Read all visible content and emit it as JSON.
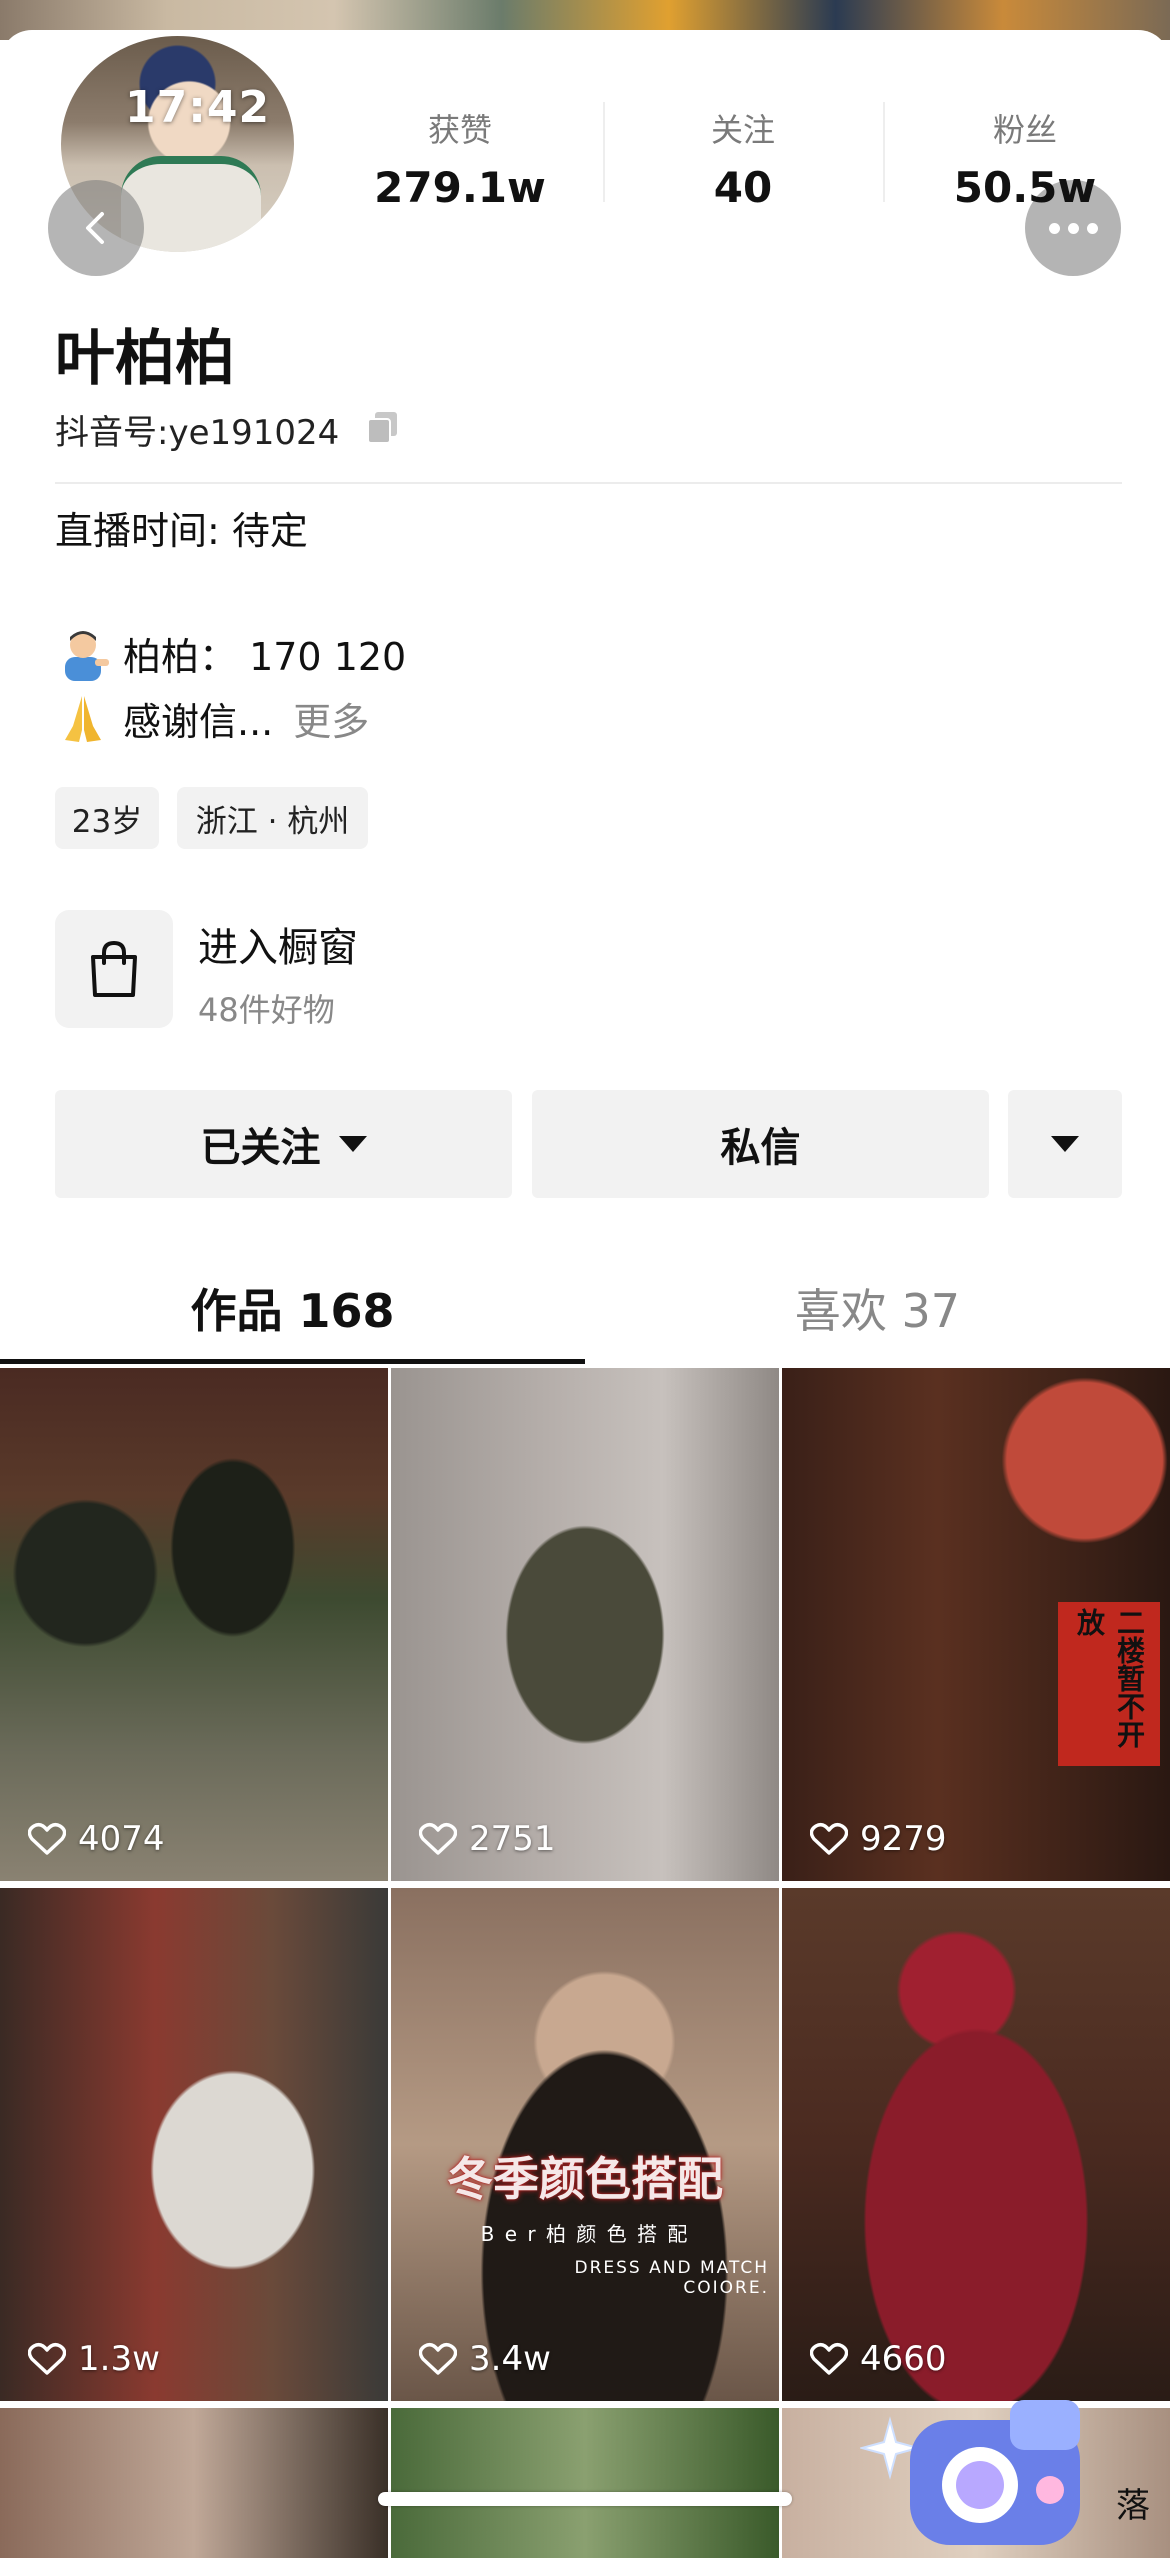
{
  "status_bar": {
    "time": "17:42"
  },
  "stats": [
    {
      "label": "获赞",
      "value": "279.1w"
    },
    {
      "label": "关注",
      "value": "40"
    },
    {
      "label": "粉丝",
      "value": "50.5w"
    }
  ],
  "profile": {
    "name": "叶柏柏",
    "douyin_id": "抖音号:ye191024",
    "live_time": "直播时间: 待定",
    "bio_line1": "柏柏： 170 120",
    "bio_line2": "感谢信...",
    "more_label": "更多",
    "tags": [
      "23岁",
      "浙江 · 杭州"
    ]
  },
  "shop": {
    "title": "进入橱窗",
    "subtitle": "48件好物"
  },
  "actions": {
    "followed_label": "已关注",
    "message_label": "私信"
  },
  "tabs": [
    {
      "label": "作品 168",
      "active": true
    },
    {
      "label": "喜欢 37",
      "active": false
    }
  ],
  "videos": [
    {
      "likes": "4074"
    },
    {
      "likes": "2751"
    },
    {
      "likes": "9279",
      "sign_text": "二楼暂不开放"
    },
    {
      "likes": "1.3w"
    },
    {
      "likes": "3.4w",
      "title": "冬季颜色搭配",
      "subtitle": "B e r 柏 颜 色 搭 配",
      "caption": "DRESS AND MATCH COIORE."
    },
    {
      "likes": "4660"
    }
  ],
  "partial_row_text": "落",
  "colors": {
    "accent": "#111111",
    "muted": "#888888",
    "tag_bg": "#f2f2f2"
  }
}
